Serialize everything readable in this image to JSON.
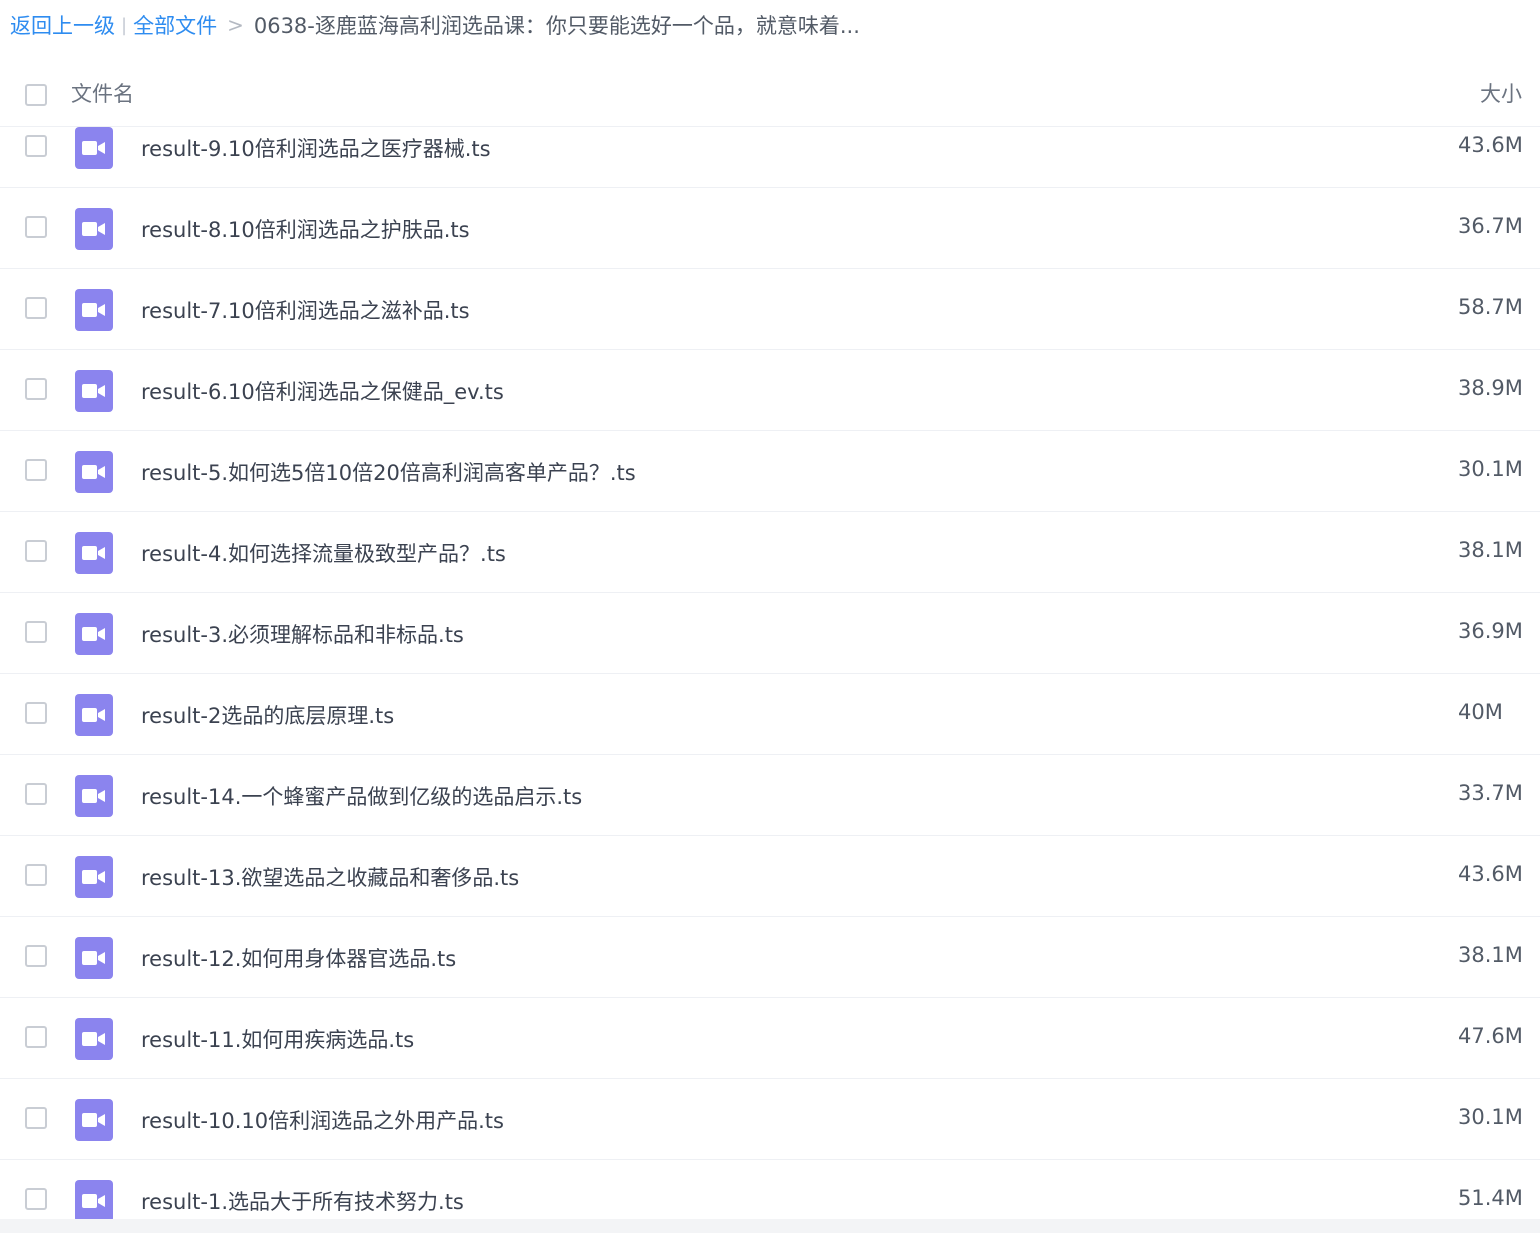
{
  "breadcrumb": {
    "back_label": "返回上一级",
    "separator": "|",
    "all_files_label": "全部文件",
    "arrow": ">",
    "current": "0638-逐鹿蓝海高利润选品课：你只要能选好一个品，就意味着..."
  },
  "header": {
    "name_label": "文件名",
    "size_label": "大小"
  },
  "colors": {
    "link": "#2e8cf0",
    "video_icon": "#8b84ee"
  },
  "files": [
    {
      "name": "result-9.10倍利润选品之医疗器械.ts",
      "size": "43.6M",
      "icon": "video-file-icon"
    },
    {
      "name": "result-8.10倍利润选品之护肤品.ts",
      "size": "36.7M",
      "icon": "video-file-icon"
    },
    {
      "name": "result-7.10倍利润选品之滋补品.ts",
      "size": "58.7M",
      "icon": "video-file-icon"
    },
    {
      "name": "result-6.10倍利润选品之保健品_ev.ts",
      "size": "38.9M",
      "icon": "video-file-icon"
    },
    {
      "name": "result-5.如何选5倍10倍20倍高利润高客单产品？.ts",
      "size": "30.1M",
      "icon": "video-file-icon"
    },
    {
      "name": "result-4.如何选择流量极致型产品？.ts",
      "size": "38.1M",
      "icon": "video-file-icon"
    },
    {
      "name": "result-3.必须理解标品和非标品.ts",
      "size": "36.9M",
      "icon": "video-file-icon"
    },
    {
      "name": "result-2选品的底层原理.ts",
      "size": "40M",
      "icon": "video-file-icon"
    },
    {
      "name": "result-14.一个蜂蜜产品做到亿级的选品启示.ts",
      "size": "33.7M",
      "icon": "video-file-icon"
    },
    {
      "name": "result-13.欲望选品之收藏品和奢侈品.ts",
      "size": "43.6M",
      "icon": "video-file-icon"
    },
    {
      "name": "result-12.如何用身体器官选品.ts",
      "size": "38.1M",
      "icon": "video-file-icon"
    },
    {
      "name": "result-11.如何用疾病选品.ts",
      "size": "47.6M",
      "icon": "video-file-icon"
    },
    {
      "name": "result-10.10倍利润选品之外用产品.ts",
      "size": "30.1M",
      "icon": "video-file-icon"
    },
    {
      "name": "result-1.选品大于所有技术努力.ts",
      "size": "51.4M",
      "icon": "video-file-icon"
    }
  ]
}
